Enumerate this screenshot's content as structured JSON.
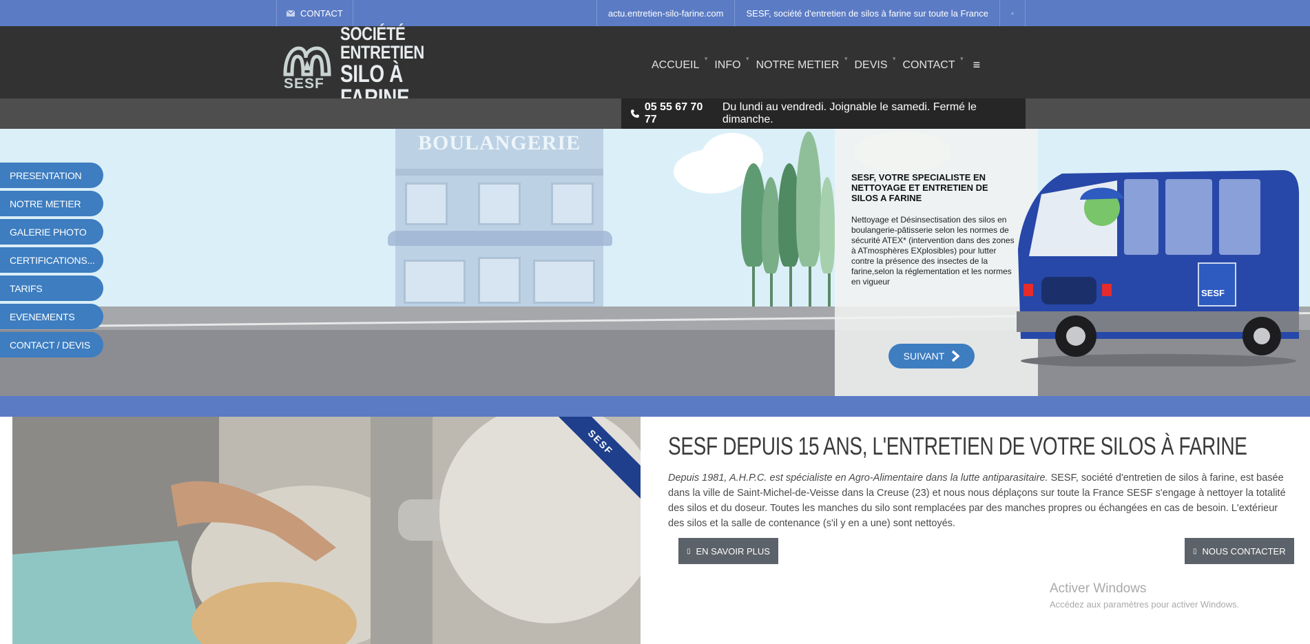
{
  "topbar": {
    "contact_label": "CONTACT",
    "site_link": "actu.entretien-silo-farine.com",
    "tagline": "SESF, société d'entretien de silos à farine sur toute la France"
  },
  "logo": {
    "mark_text": "SESF",
    "line1": "SOCIÉTÉ ENTRETIEN",
    "line2": "SILO À FARINE"
  },
  "nav": {
    "items": [
      "ACCUEIL",
      "INFO",
      "NOTRE METIER",
      "DEVIS",
      "CONTACT"
    ]
  },
  "phone": {
    "number": "05 55 67 70 77",
    "hours": "Du lundi au vendredi. Joignable le samedi. Fermé le dimanche."
  },
  "hero": {
    "bakery_sign": "BOULANGERIE",
    "heading": "SESF, VOTRE SPECIALISTE EN NETTOYAGE ET ENTRETIEN DE SILOS A FARINE",
    "text": "Nettoyage et Désinsectisation des silos en boulangerie-pâtisserie selon les normes de sécurité ATEX* (intervention dans des zones à ATmosphères EXplosibles) pour lutter contre la présence des insectes de la farine,selon la réglementation et les normes en vigueur",
    "next_label": "SUIVANT",
    "van_logo": "SESF"
  },
  "sidemenu": {
    "items": [
      "PRESENTATION",
      "NOTRE METIER",
      "GALERIE PHOTO",
      "CERTIFICATIONS...",
      "TARIFS",
      "EVENEMENTS",
      "CONTACT / DEVIS"
    ]
  },
  "photo": {
    "ribbon": "SESF"
  },
  "content": {
    "title": "SESF DEPUIS 15 ANS, L'ENTRETIEN DE VOTRE SILOS À FARINE",
    "intro_italic": "Depuis 1981, A.H.P.C. est spécialiste en Agro-Alimentaire dans la lutte antiparasitaire.",
    "body": " SESF, société d'entretien de silos à farine, est basée dans la ville de Saint-Michel-de-Veisse dans la Creuse (23) et nous nous déplaçons sur toute la France SESF s'engage à nettoyer la totalité des silos et du doseur. Toutes les manches du silo sont remplacées par des manches propres ou échangées en cas de besoin. L'extérieur des silos et la salle de contenance (s'il y en a une) sont nettoyés.",
    "more_label": "EN SAVOIR PLUS",
    "contact_label": "NOUS CONTACTER"
  },
  "watermark": {
    "title": "Activer Windows",
    "subtitle": "Accédez aux paramètres pour activer Windows."
  },
  "colors": {
    "brand_blue": "#5b7bc4",
    "button_blue": "#3d7dc0",
    "header_dark": "#323232"
  },
  "icons": [
    "envelope-icon",
    "home-icon",
    "phone-icon",
    "menu-icon",
    "chevron-right-icon",
    "caret-down-icon"
  ]
}
